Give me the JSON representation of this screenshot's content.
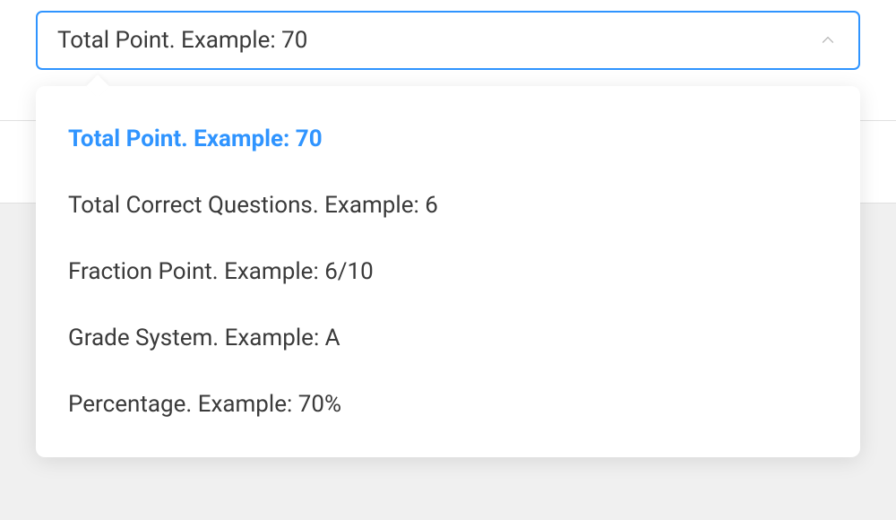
{
  "select": {
    "selected_label": "Total Point. Example: 70",
    "options": [
      {
        "label": "Total Point. Example: 70",
        "selected": true
      },
      {
        "label": "Total Correct Questions. Example: 6",
        "selected": false
      },
      {
        "label": "Fraction Point. Example: 6/10",
        "selected": false
      },
      {
        "label": "Grade System. Example: A",
        "selected": false
      },
      {
        "label": "Percentage. Example: 70%",
        "selected": false
      }
    ]
  }
}
